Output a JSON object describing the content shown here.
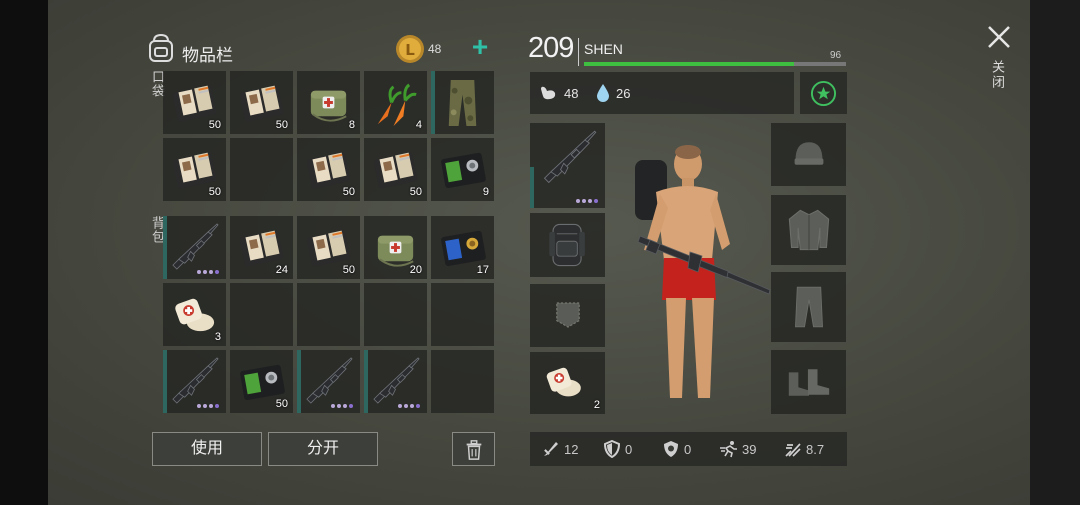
{
  "inventory": {
    "title": "物品栏",
    "coins": "48",
    "pocket_label": "口袋",
    "backpack_label": "背包",
    "pocket_slots": [
      {
        "item": "notebook-icon",
        "qty": "50",
        "marked": false
      },
      {
        "item": "notebook-icon",
        "qty": "50",
        "marked": false
      },
      {
        "item": "medkit-bag-icon",
        "qty": "8",
        "marked": false
      },
      {
        "item": "carrot-icon",
        "qty": "4",
        "marked": false
      },
      {
        "item": "camo-pants-icon",
        "qty": "",
        "marked": true
      },
      {
        "item": "notebook-icon",
        "qty": "50",
        "marked": false
      },
      {
        "item": "",
        "qty": "",
        "marked": false
      },
      {
        "item": "notebook-icon",
        "qty": "50",
        "marked": false
      },
      {
        "item": "notebook-icon",
        "qty": "50",
        "marked": false
      },
      {
        "item": "green-badge-card-icon",
        "qty": "9",
        "marked": false
      }
    ],
    "backpack_slots": [
      {
        "item": "rifle-icon",
        "qty": "",
        "marked": true,
        "dots": 4
      },
      {
        "item": "notebook-icon",
        "qty": "24",
        "marked": false
      },
      {
        "item": "notebook-icon",
        "qty": "50",
        "marked": false
      },
      {
        "item": "medkit-bag-icon",
        "qty": "20",
        "marked": false
      },
      {
        "item": "blue-badge-card-icon",
        "qty": "17",
        "marked": false
      },
      {
        "item": "bandage-icon",
        "qty": "3",
        "marked": false
      },
      {
        "item": "",
        "qty": "",
        "marked": false
      },
      {
        "item": "",
        "qty": "",
        "marked": false
      },
      {
        "item": "",
        "qty": "",
        "marked": false
      },
      {
        "item": "",
        "qty": "",
        "marked": false
      },
      {
        "item": "rifle-icon",
        "qty": "",
        "marked": true,
        "dots": 4
      },
      {
        "item": "green-badge-card-icon",
        "qty": "50",
        "marked": false
      },
      {
        "item": "rifle-icon",
        "qty": "",
        "marked": true,
        "dots": 4
      },
      {
        "item": "rifle-icon",
        "qty": "",
        "marked": true,
        "dots": 4
      },
      {
        "item": "",
        "qty": "",
        "marked": false
      }
    ],
    "use_label": "使用",
    "split_label": "分开"
  },
  "character": {
    "level": "209",
    "name": "SHEN",
    "xp_value": "96",
    "xp_fraction": 0.8,
    "food": "48",
    "water": "26",
    "medkit_qty": "2",
    "stats": [
      {
        "icon": "attack-icon",
        "value": "12"
      },
      {
        "icon": "defense-icon",
        "value": "0"
      },
      {
        "icon": "radiation-armor-icon",
        "value": "0"
      },
      {
        "icon": "speed-icon",
        "value": "39"
      },
      {
        "icon": "stealth-icon",
        "value": "8.7"
      }
    ]
  },
  "close_label": "关闭",
  "colors": {
    "accent_teal": "#2fc0a8",
    "xp_green": "#3fbf3f",
    "slot_marker": "#2e6660"
  }
}
